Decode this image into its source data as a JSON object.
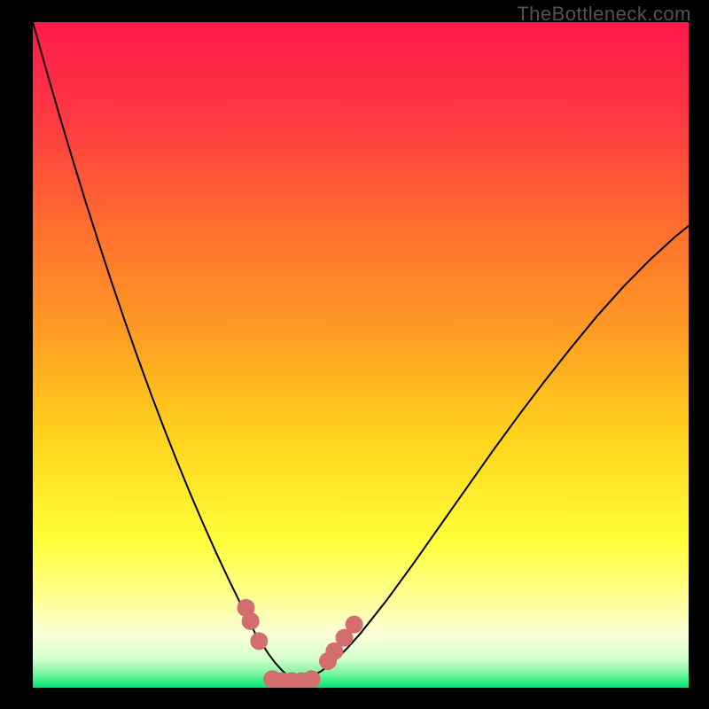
{
  "watermark": "TheBottleneck.com",
  "chart_data": {
    "type": "line",
    "title": "",
    "xlabel": "",
    "ylabel": "",
    "xlim": [
      0,
      100
    ],
    "ylim": [
      0,
      100
    ],
    "grid": false,
    "legend": false,
    "series": [
      {
        "name": "left-curve",
        "x": [
          0,
          2,
          4,
          6,
          8,
          10,
          12,
          14,
          16,
          18,
          20,
          22,
          24,
          26,
          28,
          30,
          32,
          33,
          34,
          35,
          36,
          37,
          38,
          39,
          40
        ],
        "y": [
          100,
          93,
          86.2,
          79.6,
          73.2,
          67,
          61,
          55.2,
          49.6,
          44.2,
          39,
          34,
          29.2,
          24.6,
          20.2,
          16,
          12,
          10,
          8,
          6.5,
          5,
          3.7,
          2.6,
          1.7,
          1
        ]
      },
      {
        "name": "right-curve",
        "x": [
          40,
          42,
          44,
          46,
          48,
          50,
          54,
          58,
          62,
          66,
          70,
          74,
          78,
          82,
          86,
          90,
          94,
          98,
          100
        ],
        "y": [
          1,
          1.5,
          2.5,
          4,
          6,
          8.2,
          13.2,
          18.6,
          24.2,
          29.8,
          35.4,
          40.8,
          46,
          51,
          55.8,
          60.2,
          64.2,
          67.8,
          69.4
        ]
      }
    ],
    "markers": [
      {
        "name": "left-marker-1",
        "x": 32.5,
        "y": 12
      },
      {
        "name": "left-marker-2",
        "x": 33.2,
        "y": 10
      },
      {
        "name": "left-marker-3",
        "x": 34.5,
        "y": 7
      },
      {
        "name": "bottom-marker-1",
        "x": 36.5,
        "y": 1.3
      },
      {
        "name": "bottom-marker-2",
        "x": 38.0,
        "y": 1.0
      },
      {
        "name": "bottom-marker-3",
        "x": 39.5,
        "y": 1.0
      },
      {
        "name": "bottom-marker-4",
        "x": 41.0,
        "y": 1.0
      },
      {
        "name": "bottom-marker-5",
        "x": 42.5,
        "y": 1.3
      },
      {
        "name": "right-marker-1",
        "x": 45.0,
        "y": 4.0
      },
      {
        "name": "right-marker-2",
        "x": 46.0,
        "y": 5.5
      },
      {
        "name": "right-marker-3",
        "x": 47.5,
        "y": 7.5
      },
      {
        "name": "right-marker-4",
        "x": 49.0,
        "y": 9.5
      }
    ],
    "colors": {
      "gradient_top": "#ff1a4b",
      "gradient_upper": "#ff7b2b",
      "gradient_mid": "#ffd21c",
      "gradient_lower": "#ffff66",
      "gradient_pale": "#feffd4",
      "gradient_bottom": "#00e873",
      "curve": "#000000",
      "marker": "#d46d6d"
    }
  }
}
